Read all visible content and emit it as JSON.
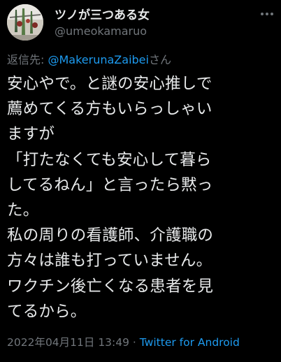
{
  "author": {
    "display_name": "ツノが三つある女",
    "handle": "@umeokamaruo"
  },
  "reply": {
    "prefix": "返信先: ",
    "mention": "@MakerunaZaibei",
    "suffix": "さん"
  },
  "tweet": {
    "lines": [
      "安心やで。と謎の安心推しで",
      "薦めてくる方もいらっしゃい",
      "ますが",
      "「打たなくても安心して暮ら",
      "してるねん」と言ったら黙っ",
      "た。",
      "私の周りの看護師、介護職の",
      "方々は誰も打っていません。",
      "ワクチン後亡くなる患者を見",
      "てるから。"
    ]
  },
  "meta": {
    "timestamp": "2022年04月11日 13:49",
    "separator": " · ",
    "source": "Twitter for Android"
  },
  "icons": {
    "more": "more-options-icon",
    "avatar": "avatar-image"
  },
  "colors": {
    "background": "#000000",
    "text": "#e7e9ea",
    "secondary": "#71767b",
    "link": "#1d9bf0"
  }
}
